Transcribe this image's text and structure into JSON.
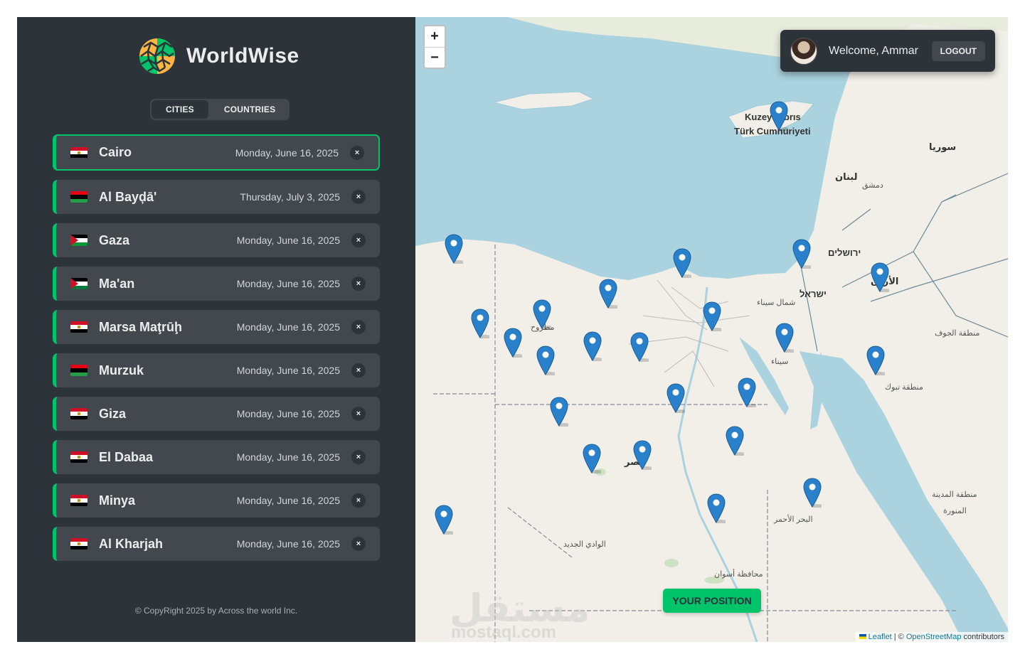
{
  "app": {
    "name": "WorldWise"
  },
  "tabs": [
    {
      "label": "CITIES",
      "active": true
    },
    {
      "label": "COUNTRIES",
      "active": false
    }
  ],
  "cities": [
    {
      "name": "Cairo",
      "date": "Monday, June 16, 2025",
      "flag": "egypt",
      "active": true
    },
    {
      "name": "Al Bayḑā'",
      "date": "Thursday, July 3, 2025",
      "flag": "libya",
      "active": false
    },
    {
      "name": "Gaza",
      "date": "Monday, June 16, 2025",
      "flag": "palestine",
      "active": false
    },
    {
      "name": "Ma'an",
      "date": "Monday, June 16, 2025",
      "flag": "jordan",
      "active": false
    },
    {
      "name": "Marsa Maţrūḩ",
      "date": "Monday, June 16, 2025",
      "flag": "egypt",
      "active": false
    },
    {
      "name": "Murzuk",
      "date": "Monday, June 16, 2025",
      "flag": "libya",
      "active": false
    },
    {
      "name": "Giza",
      "date": "Monday, June 16, 2025",
      "flag": "egypt",
      "active": false
    },
    {
      "name": "El Dabaa",
      "date": "Monday, June 16, 2025",
      "flag": "egypt",
      "active": false
    },
    {
      "name": "Minya",
      "date": "Monday, June 16, 2025",
      "flag": "egypt",
      "active": false
    },
    {
      "name": "Al Kharjah",
      "date": "Monday, June 16, 2025",
      "flag": "egypt",
      "active": false
    }
  ],
  "delete_symbol": "×",
  "footer": "© CopyRight 2025 by Across the world Inc.",
  "map": {
    "zoom_in": "+",
    "zoom_out": "−",
    "welcome": "Welcome, Ammar",
    "logout": "LOGOUT",
    "position_button": "YOUR POSITION",
    "attribution": {
      "leaflet": "Leaflet",
      "sep": " | © ",
      "osm": "OpenStreetMap",
      "rest": " contributors"
    },
    "labels": {
      "cyprus1": "Kuzey Kıbrıs",
      "cyprus2": "Türk Cumhuriyeti",
      "syria": "سوريا",
      "lebanon": "لبنان",
      "damascus": "دمشق",
      "jerusalem": "ירושלים",
      "israel": "ישראל",
      "jordan": "الأردن",
      "north_sinai": "شمال سيناء",
      "sinai": "سيناء",
      "jawf": "منطقة الجوف",
      "tabuk": "منطقة تبوك",
      "madinah": "منطقة المدينة",
      "munawwara": "المنورة",
      "matrouh": "مطروح",
      "egypt": "مصر",
      "red_sea": "البحر الأحمر",
      "new_valley": "الوادي الجديد",
      "aswan": "محافظة أسوان",
      "watermark": "مستقل",
      "watermark_en": "mostaql.com"
    },
    "colors": {
      "sea": "#aad3df",
      "land": "#f2efe9",
      "pin": "#2a81cb",
      "accent": "#00c46a"
    }
  }
}
